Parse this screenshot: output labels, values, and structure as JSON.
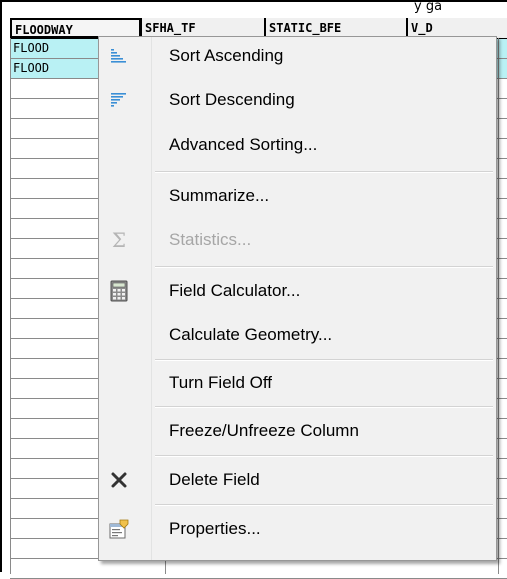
{
  "partial_title": "y ga",
  "table": {
    "headers": [
      "FLOODWAY",
      "SFHA_TF",
      "STATIC_BFE",
      "V_D"
    ],
    "rows": [
      [
        "FLOOD",
        "",
        "",
        ""
      ],
      [
        "FLOOD",
        "",
        "",
        ""
      ]
    ],
    "selected_row_color": "#b9f1f4"
  },
  "menu": {
    "items": [
      {
        "label": "Sort Ascending",
        "icon": "sort-ascending-icon",
        "enabled": true
      },
      {
        "label": "Sort Descending",
        "icon": "sort-descending-icon",
        "enabled": true
      },
      {
        "label": "Advanced Sorting...",
        "icon": "",
        "enabled": true
      },
      {
        "label": "Summarize...",
        "icon": "",
        "enabled": true
      },
      {
        "label": "Statistics...",
        "icon": "sigma-icon",
        "enabled": false
      },
      {
        "label": "Field Calculator...",
        "icon": "calculator-icon",
        "enabled": true
      },
      {
        "label": "Calculate Geometry...",
        "icon": "",
        "enabled": true
      },
      {
        "label": "Turn Field Off",
        "icon": "",
        "enabled": true
      },
      {
        "label": "Freeze/Unfreeze Column",
        "icon": "",
        "enabled": true
      },
      {
        "label": "Delete Field",
        "icon": "delete-x-icon",
        "enabled": true
      },
      {
        "label": "Properties...",
        "icon": "properties-icon",
        "enabled": true
      }
    ]
  }
}
